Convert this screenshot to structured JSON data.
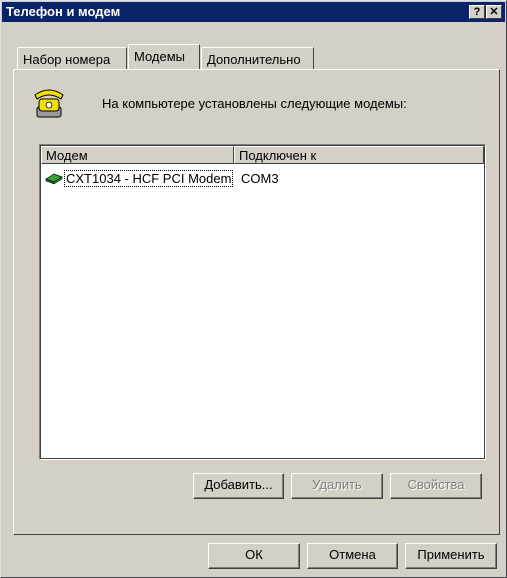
{
  "window": {
    "title": "Телефон и модем",
    "help_label": "?",
    "close_label": "✕"
  },
  "tabs": [
    {
      "label": "Набор номера",
      "active": false
    },
    {
      "label": "Модемы",
      "active": true
    },
    {
      "label": "Дополнительно",
      "active": false
    }
  ],
  "info": {
    "icon": "telephone-icon",
    "text": "На компьютере установлены следующие модемы:"
  },
  "list": {
    "columns": [
      "Модем",
      "Подключен к"
    ],
    "rows": [
      {
        "icon": "modem-icon",
        "name": "CXT1034 - HCF PCI Modem",
        "port": "COM3"
      }
    ]
  },
  "list_buttons": {
    "add": "Добавить...",
    "remove": "Удалить",
    "properties": "Свойства"
  },
  "dialog_buttons": {
    "ok": "ОК",
    "cancel": "Отмена",
    "apply": "Применить"
  }
}
